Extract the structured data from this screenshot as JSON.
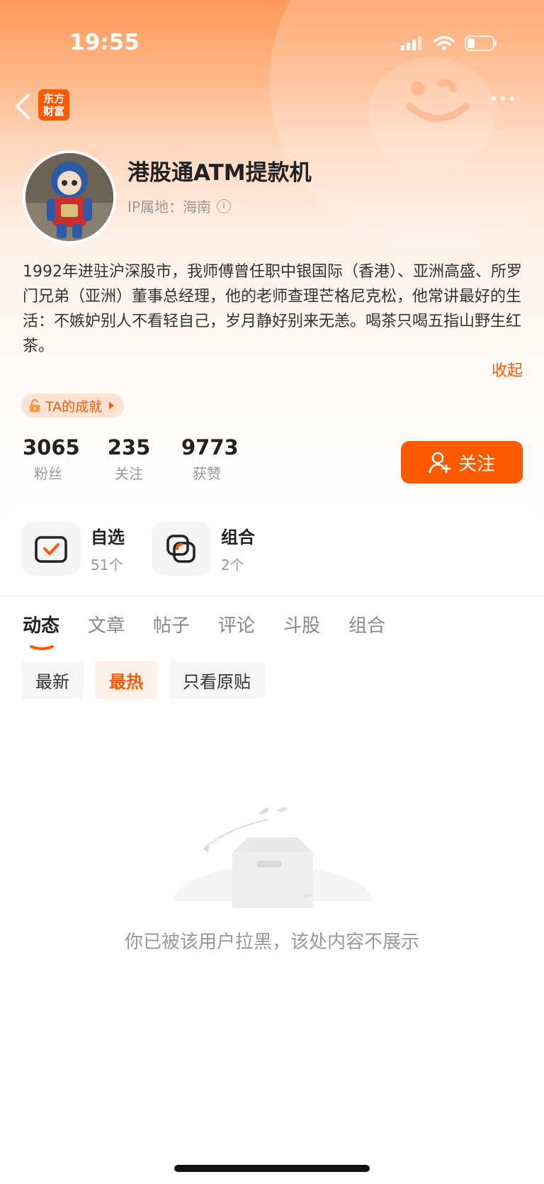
{
  "status_bar": {
    "time": "19:55"
  },
  "nav": {
    "logo_line1": "东方",
    "logo_line2": "财富"
  },
  "profile": {
    "username": "港股通ATM提款机",
    "ip_label": "IP属地：海南",
    "bio": "1992年进驻沪深股市，我师傅曾任职中银国际（香港）、亚洲高盛、所罗门兄弟（亚洲）董事总经理，他的老师查理芒格尼克松，他常讲最好的生活：不嫉妒别人不看轻自己，岁月静好别来无恙。喝茶只喝五指山野生红茶。",
    "collapse_label": "收起",
    "achievement_label": "TA的成就"
  },
  "stats": [
    {
      "value": "3065",
      "label": "粉丝"
    },
    {
      "value": "235",
      "label": "关注"
    },
    {
      "value": "9773",
      "label": "获赞"
    }
  ],
  "follow_button": {
    "label": "关注"
  },
  "quick_links": [
    {
      "title": "自选",
      "count": "51个",
      "icon": "watchlist-check-icon"
    },
    {
      "title": "组合",
      "count": "2个",
      "icon": "portfolio-icon"
    }
  ],
  "tabs": [
    {
      "label": "动态",
      "active": true
    },
    {
      "label": "文章",
      "active": false
    },
    {
      "label": "帖子",
      "active": false
    },
    {
      "label": "评论",
      "active": false
    },
    {
      "label": "斗股",
      "active": false
    },
    {
      "label": "组合",
      "active": false
    }
  ],
  "filters": [
    {
      "label": "最新",
      "active": false
    },
    {
      "label": "最热",
      "active": true
    },
    {
      "label": "只看原贴",
      "active": false
    }
  ],
  "empty_state": {
    "message": "你已被该用户拉黑，该处内容不展示"
  },
  "colors": {
    "accent": "#ff5a00",
    "accent_light": "#fff0e8"
  }
}
